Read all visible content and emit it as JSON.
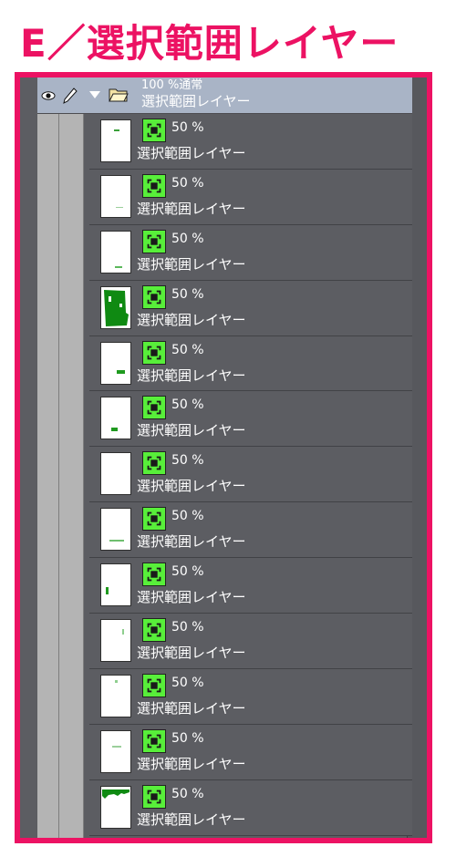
{
  "title": "E／選択範囲レイヤー",
  "folder": {
    "opacity_mode": "100 %通常",
    "name": "選択範囲レイヤー"
  },
  "layers": [
    {
      "opacity": "50 %",
      "name": "選択範囲レイヤー",
      "thumb": "speck-top"
    },
    {
      "opacity": "50 %",
      "name": "選択範囲レイヤー",
      "thumb": "speck-mid"
    },
    {
      "opacity": "50 %",
      "name": "選択範囲レイヤー",
      "thumb": "speck-low"
    },
    {
      "opacity": "50 %",
      "name": "選択範囲レイヤー",
      "thumb": "large-fill"
    },
    {
      "opacity": "50 %",
      "name": "選択範囲レイヤー",
      "thumb": "block-right"
    },
    {
      "opacity": "50 %",
      "name": "選択範囲レイヤー",
      "thumb": "block-left"
    },
    {
      "opacity": "50 %",
      "name": "選択範囲レイヤー",
      "thumb": "blank"
    },
    {
      "opacity": "50 %",
      "name": "選択範囲レイヤー",
      "thumb": "dash-low"
    },
    {
      "opacity": "50 %",
      "name": "選択範囲レイヤー",
      "thumb": "mark-left"
    },
    {
      "opacity": "50 %",
      "name": "選択範囲レイヤー",
      "thumb": "tick-right"
    },
    {
      "opacity": "50 %",
      "name": "選択範囲レイヤー",
      "thumb": "dot-top"
    },
    {
      "opacity": "50 %",
      "name": "選択範囲レイヤー",
      "thumb": "text-small"
    },
    {
      "opacity": "50 %",
      "name": "選択範囲レイヤー",
      "thumb": "drip-top"
    }
  ],
  "colors": {
    "accent": "#ec1263",
    "selection_green": "#58ef3a",
    "panel_bg": "#5c5d62",
    "folder_bg": "#a9b4c6"
  }
}
